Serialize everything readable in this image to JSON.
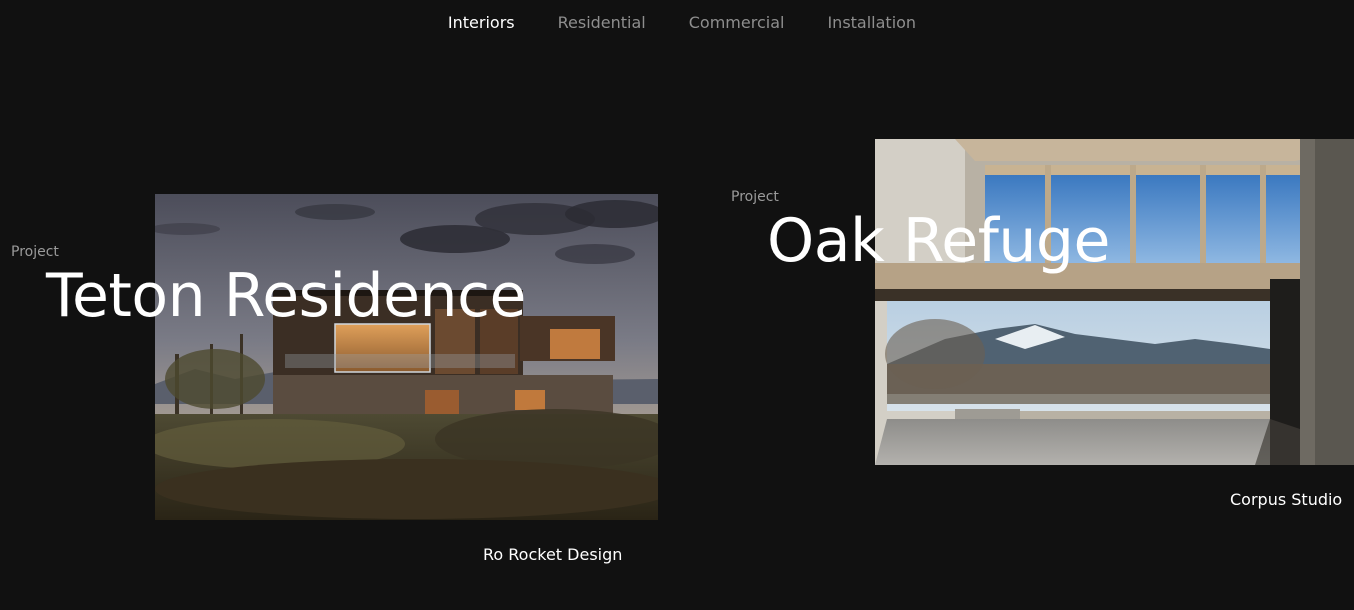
{
  "nav": {
    "items": [
      {
        "label": "Interiors",
        "active": true
      },
      {
        "label": "Residential",
        "active": false
      },
      {
        "label": "Commercial",
        "active": false
      },
      {
        "label": "Installation",
        "active": false
      }
    ]
  },
  "projects": [
    {
      "label": "Project",
      "title": "Teton Residence",
      "credit": "Ro Rocket Design"
    },
    {
      "label": "Project",
      "title": "Oak Refuge",
      "credit": "Corpus Studio"
    }
  ],
  "colors": {
    "background": "#111111",
    "nav_inactive": "#8e8e8e",
    "nav_active": "#ffffff",
    "label": "#9a9a9a"
  }
}
